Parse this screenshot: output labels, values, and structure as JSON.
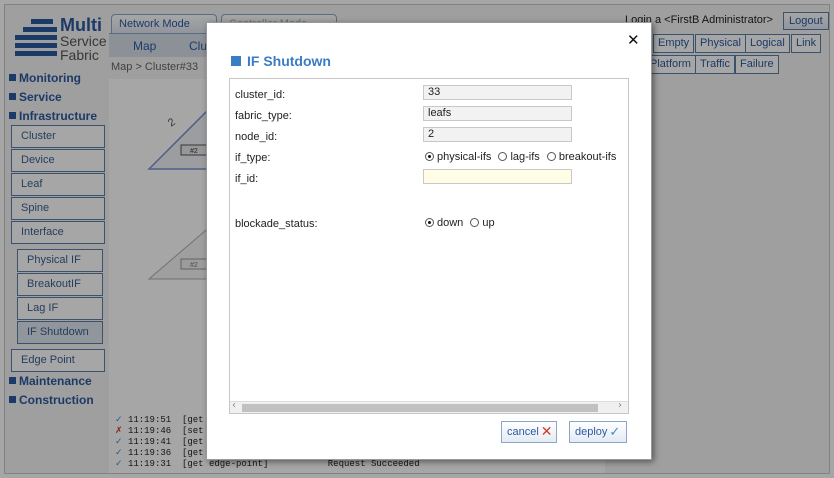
{
  "logo": {
    "line1": "Multi",
    "line2": "Service",
    "line3": "Fabric"
  },
  "mode_tabs": [
    {
      "label": "Network Mode"
    },
    {
      "label": "Controller Mode"
    }
  ],
  "sub_tabs": [
    {
      "label": "Map"
    },
    {
      "label": "Clus"
    }
  ],
  "breadcrumb": "Map > Cluster#33",
  "header": {
    "login_text": "Login a <FirstB Administrator>",
    "logout_label": "Logout"
  },
  "view_buttons": {
    "row1": [
      "Empty",
      "Physical",
      "Logical",
      "Link"
    ],
    "row2": [
      "Platform",
      "Traffic",
      "Failure"
    ]
  },
  "sidebar": {
    "monitoring": "Monitoring",
    "service": "Service",
    "infrastructure": "Infrastructure",
    "infra_items": [
      "Cluster",
      "Device",
      "Leaf",
      "Spine",
      "Interface"
    ],
    "interface_items": [
      "Physical IF",
      "BreakoutIF",
      "Lag IF",
      "IF Shutdown"
    ],
    "edge_point": "Edge Point",
    "maintenance": "Maintenance",
    "construction": "Construction"
  },
  "canvas": {
    "cluster_label": "2",
    "node_label_1": "#2",
    "node_label_2": "#2"
  },
  "log": [
    {
      "status": "ok",
      "text": "11:19:51  [get e"
    },
    {
      "status": "error",
      "text": "11:19:46  [set e"
    },
    {
      "status": "ok",
      "text": "11:19:41  [get r"
    },
    {
      "status": "ok",
      "text": "11:19:36  [get e"
    },
    {
      "status": "ok",
      "text": "11:19:31  [get edge-point]           Request Succeeded"
    }
  ],
  "dialog": {
    "title": "IF Shutdown",
    "close_symbol": "✕",
    "fields": {
      "cluster_id": {
        "label": "cluster_id:",
        "value": "33"
      },
      "fabric_type": {
        "label": "fabric_type:",
        "value": "leafs"
      },
      "node_id": {
        "label": "node_id:",
        "value": "2"
      },
      "if_type": {
        "label": "if_type:",
        "options": [
          "physical-ifs",
          "lag-ifs",
          "breakout-ifs"
        ],
        "selected": "physical-ifs"
      },
      "if_id": {
        "label": "if_id:",
        "value": ""
      },
      "blockade_status": {
        "label": "blockade_status:",
        "options": [
          "down",
          "up"
        ],
        "selected": "down"
      }
    },
    "cancel_label": "cancel",
    "deploy_label": "deploy"
  },
  "colors": {
    "accent": "#3a7cc6",
    "nav_blue": "#2c5aa0",
    "error_red": "#d23b2a",
    "ok_blue": "#3a8ed6"
  }
}
